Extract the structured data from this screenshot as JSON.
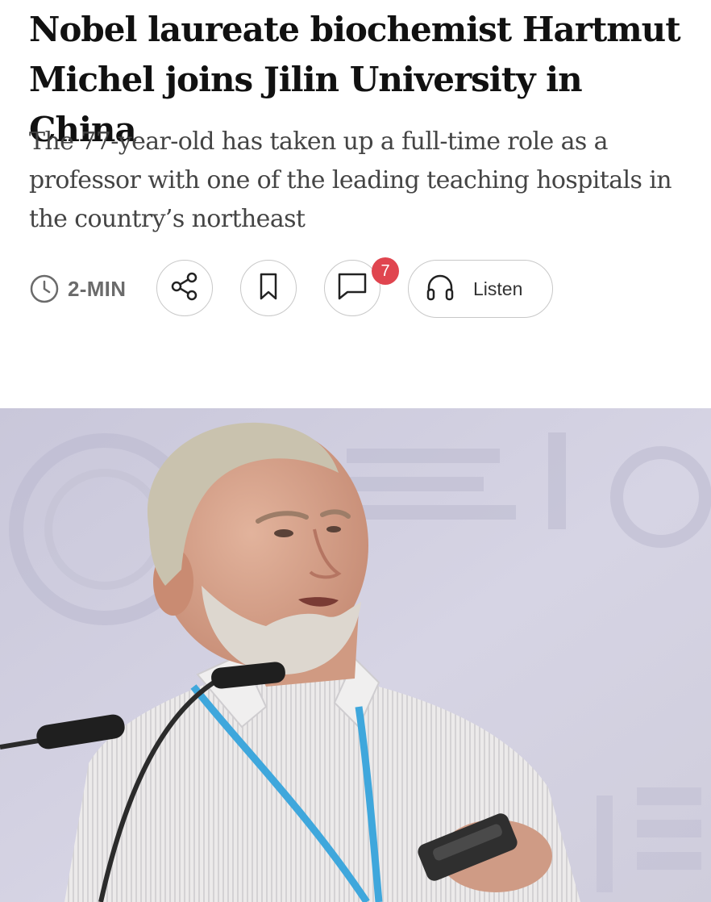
{
  "article": {
    "headline": "Nobel laureate biochemist Hartmut Michel joins Jilin University in China",
    "subheadline": "The 77-year-old has taken up a full-time role as a professor with one of the leading teaching hospitals in the country’s northeast"
  },
  "toolbar": {
    "read_time": "2-MIN",
    "comment_count": "7",
    "listen_label": "Listen",
    "icons": {
      "read_time": "clock-icon",
      "share": "share-icon",
      "bookmark": "bookmark-icon",
      "comments": "comment-icon",
      "listen": "headphones-icon"
    }
  },
  "colors": {
    "headline": "#111111",
    "subheadline": "#444444",
    "meta_text": "#6b6b6b",
    "button_border": "#c8c8c8",
    "badge": "#e0454f",
    "photo_background": "#d2d0e0",
    "lanyard": "#3fa7dc"
  }
}
